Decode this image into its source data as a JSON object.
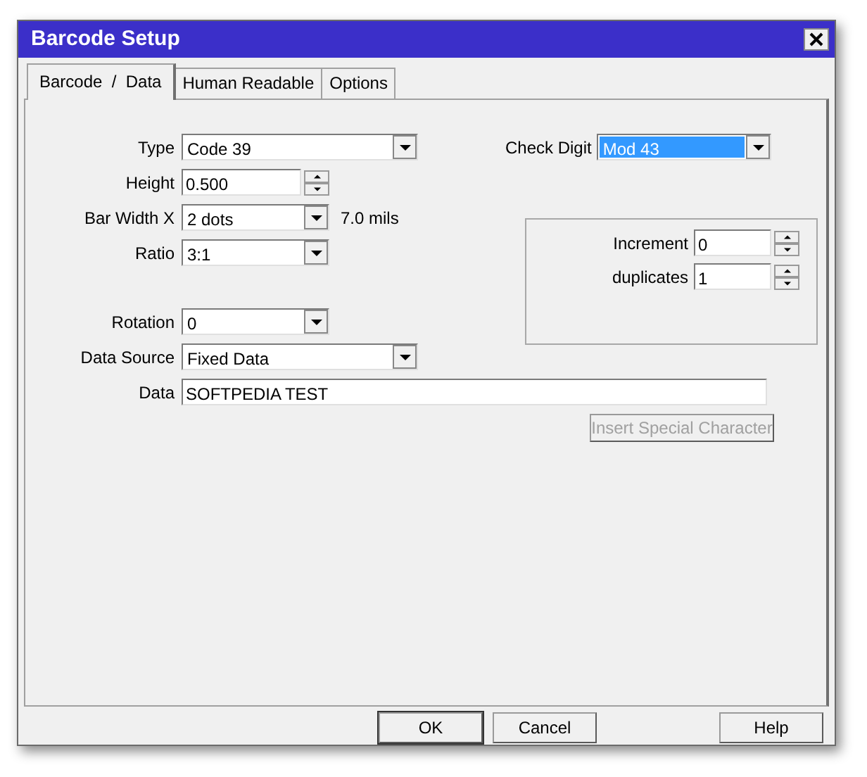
{
  "window": {
    "title": "Barcode Setup"
  },
  "tabs": [
    {
      "label": "Barcode  /  Data",
      "selected": true
    },
    {
      "label": "Human Readable",
      "selected": false
    },
    {
      "label": "Options",
      "selected": false
    }
  ],
  "barcode_fields": [
    {
      "label": "Type",
      "kind": "longcombo",
      "value": "Code 39"
    },
    {
      "label": "Height",
      "kind": "spin",
      "value": "0.500"
    },
    {
      "label": "Bar Width X",
      "kind": "combo",
      "value": "2 dots",
      "note": "7.0 mils"
    },
    {
      "label": "Ratio",
      "kind": "combo",
      "value": "3:1"
    }
  ],
  "source_fields": [
    {
      "label": "Rotation",
      "kind": "combo",
      "value": "0"
    },
    {
      "label": "Data Source",
      "kind": "longcombo",
      "value": "Fixed Data"
    }
  ],
  "check_digit": {
    "label": "Check Digit",
    "value": "Mod 43",
    "selected": true
  },
  "counters": [
    {
      "label": "Increment",
      "value": "0"
    },
    {
      "label": "duplicates",
      "value": "1"
    }
  ],
  "data": {
    "label": "Data",
    "value": "SOFTPEDIA TEST"
  },
  "insert_button": {
    "label": "Insert Special Character",
    "disabled": true
  },
  "footer_buttons": [
    {
      "label": "OK",
      "default": true
    },
    {
      "label": "Cancel",
      "default": false
    }
  ],
  "help_button": {
    "label": "Help"
  }
}
